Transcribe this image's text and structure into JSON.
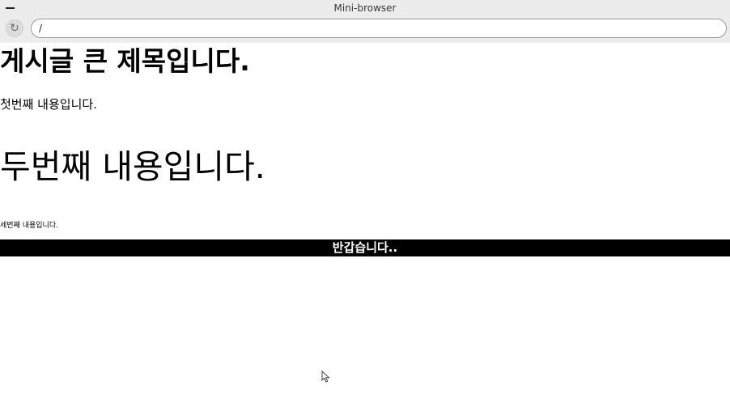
{
  "window": {
    "title": "Mini-browser"
  },
  "toolbar": {
    "url": "/",
    "reload_icon": "reload-icon"
  },
  "page": {
    "heading": "게시글 큰 제목입니다.",
    "para1": "첫번째 내용입니다.",
    "para2": "두번째 내용입니다.",
    "para3": "세번째 내용입니다.",
    "banner": "반갑습니다.."
  }
}
